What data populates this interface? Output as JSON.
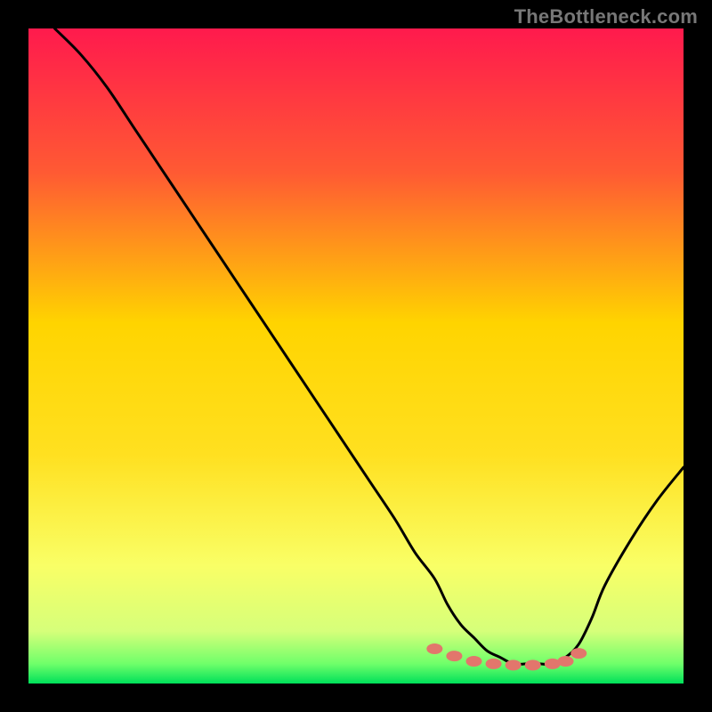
{
  "watermark": "TheBottleneck.com",
  "chart_data": {
    "type": "line",
    "title": "",
    "xlabel": "",
    "ylabel": "",
    "xlim": [
      0,
      100
    ],
    "ylim": [
      0,
      100
    ],
    "background_gradient": {
      "top": "#ff1a4d",
      "upper_mid": "#ff7a2a",
      "mid": "#ffd400",
      "lower_mid": "#f9ff66",
      "near_bottom": "#d6ff7a",
      "bottom": "#00e05a"
    },
    "x": [
      4,
      8,
      12,
      16,
      20,
      24,
      28,
      32,
      36,
      40,
      44,
      48,
      52,
      56,
      59,
      62,
      64,
      66,
      68,
      70,
      72,
      74,
      76,
      78,
      80,
      82,
      84,
      86,
      88,
      92,
      96,
      100
    ],
    "values": [
      100,
      96,
      91,
      85,
      79,
      73,
      67,
      61,
      55,
      49,
      43,
      37,
      31,
      25,
      20,
      16,
      12,
      9,
      7,
      5,
      4,
      3,
      3,
      3,
      3,
      4,
      6,
      10,
      15,
      22,
      28,
      33
    ],
    "dotted_band": {
      "x": [
        62,
        65,
        68,
        71,
        74,
        77,
        80,
        82,
        84
      ],
      "y": [
        5.3,
        4.2,
        3.4,
        3.0,
        2.8,
        2.8,
        3.0,
        3.4,
        4.6
      ]
    },
    "colors": {
      "line": "#000000",
      "dots": "#e2766c"
    }
  }
}
